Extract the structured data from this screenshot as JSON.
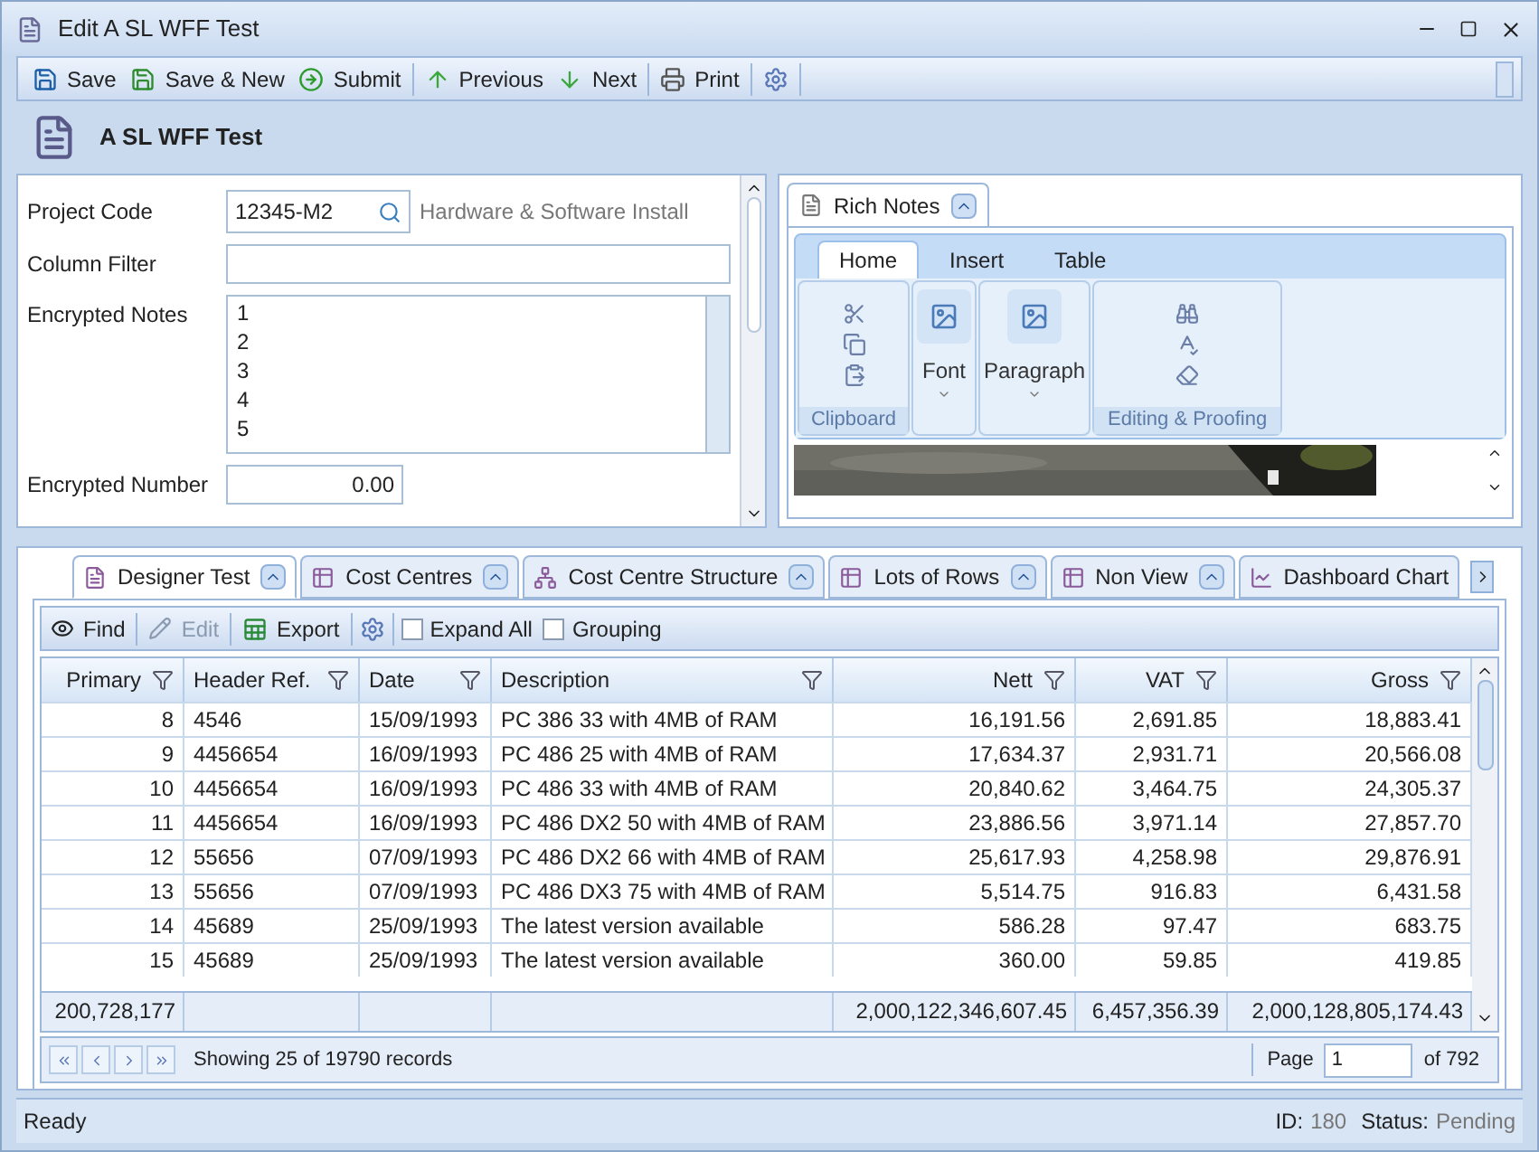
{
  "window": {
    "title": "Edit A SL WFF Test"
  },
  "toolbar": [
    {
      "buttons": [
        "Save",
        "Save & New",
        "Submit"
      ]
    },
    {
      "buttons": [
        "Previous",
        "Next"
      ]
    },
    {
      "buttons": [
        "Print"
      ]
    }
  ],
  "header": {
    "title": "A SL WFF Test"
  },
  "form": {
    "project_code": {
      "label": "Project Code",
      "value": "12345-M2",
      "description": "Hardware & Software Install"
    },
    "column_filter": {
      "label": "Column Filter"
    },
    "encrypted_notes": {
      "label": "Encrypted Notes",
      "lines": [
        "1",
        "2",
        "3",
        "4",
        "5"
      ]
    },
    "encrypted_number": {
      "label": "Encrypted Number",
      "value": "0.00"
    }
  },
  "rich_notes": {
    "tab": "Rich Notes",
    "ribbon_tabs": [
      {
        "label": "Home",
        "selected": true
      },
      {
        "label": "Insert",
        "selected": false
      },
      {
        "label": "Table",
        "selected": false
      }
    ],
    "groups": [
      {
        "kind": "clipboard",
        "label": "Clipboard"
      },
      {
        "kind": "big",
        "label": "Font"
      },
      {
        "kind": "big",
        "label": "Paragraph"
      },
      {
        "kind": "editing",
        "label": "Editing & Proofing"
      }
    ]
  },
  "tabs": [
    {
      "label": "Designer Test",
      "selected": true
    },
    {
      "label": "Cost Centres",
      "selected": false
    },
    {
      "label": "Cost Centre Structure",
      "selected": false
    },
    {
      "label": "Lots of Rows",
      "selected": false
    },
    {
      "label": "Non View",
      "selected": false
    },
    {
      "label": "Dashboard Chart",
      "selected": false
    }
  ],
  "grid_toolbar": {
    "find": "Find",
    "edit": {
      "label": "Edit",
      "disabled": true
    },
    "export": "Export",
    "checkboxes": [
      {
        "label": "Expand All",
        "checked": false
      },
      {
        "label": "Grouping",
        "checked": false
      }
    ]
  },
  "table": {
    "columns": [
      {
        "label": "Primary",
        "kind": "number",
        "has_total": true
      },
      {
        "label": "Header Ref.",
        "kind": "text",
        "has_total": false
      },
      {
        "label": "Date",
        "kind": "text",
        "has_total": false
      },
      {
        "label": "Description",
        "kind": "text",
        "has_total": false
      },
      {
        "label": "Nett",
        "kind": "number",
        "has_total": true
      },
      {
        "label": "VAT",
        "kind": "number",
        "has_total": true
      },
      {
        "label": "Gross",
        "kind": "number",
        "has_total": true
      }
    ],
    "rows": [
      [
        "8",
        "4546",
        "15/09/1993",
        "PC 386 33 with 4MB of RAM",
        "16,191.56",
        "2,691.85",
        "18,883.41"
      ],
      [
        "9",
        "4456654",
        "16/09/1993",
        "PC 486 25 with 4MB of RAM",
        "17,634.37",
        "2,931.71",
        "20,566.08"
      ],
      [
        "10",
        "4456654",
        "16/09/1993",
        "PC 486 33 with 4MB of RAM",
        "20,840.62",
        "3,464.75",
        "24,305.37"
      ],
      [
        "11",
        "4456654",
        "16/09/1993",
        "PC 486 DX2 50 with 4MB of RAM",
        "23,886.56",
        "3,971.14",
        "27,857.70"
      ],
      [
        "12",
        "55656",
        "07/09/1993",
        "PC 486 DX2 66 with 4MB of RAM",
        "25,617.93",
        "4,258.98",
        "29,876.91"
      ],
      [
        "13",
        "55656",
        "07/09/1993",
        "PC 486 DX3 75 with 4MB of RAM",
        "5,514.75",
        "916.83",
        "6,431.58"
      ],
      [
        "14",
        "45689",
        "25/09/1993",
        "The latest version available",
        "586.28",
        "97.47",
        "683.75"
      ],
      [
        "15",
        "45689",
        "25/09/1993",
        "The latest version available",
        "360.00",
        "59.85",
        "419.85"
      ]
    ],
    "totals": [
      "200,728,177",
      "2,000,122,346,607.45",
      "6,457,356.39",
      "2,000,128,805,174.43"
    ]
  },
  "pager": {
    "status": "Showing 25 of 19790 records",
    "page_label": "Page",
    "page": "1",
    "of": "of 792"
  },
  "status_bar": {
    "text": "Ready",
    "id_label": "ID:",
    "id": "180",
    "status_label": "Status:",
    "status": "Pending"
  }
}
